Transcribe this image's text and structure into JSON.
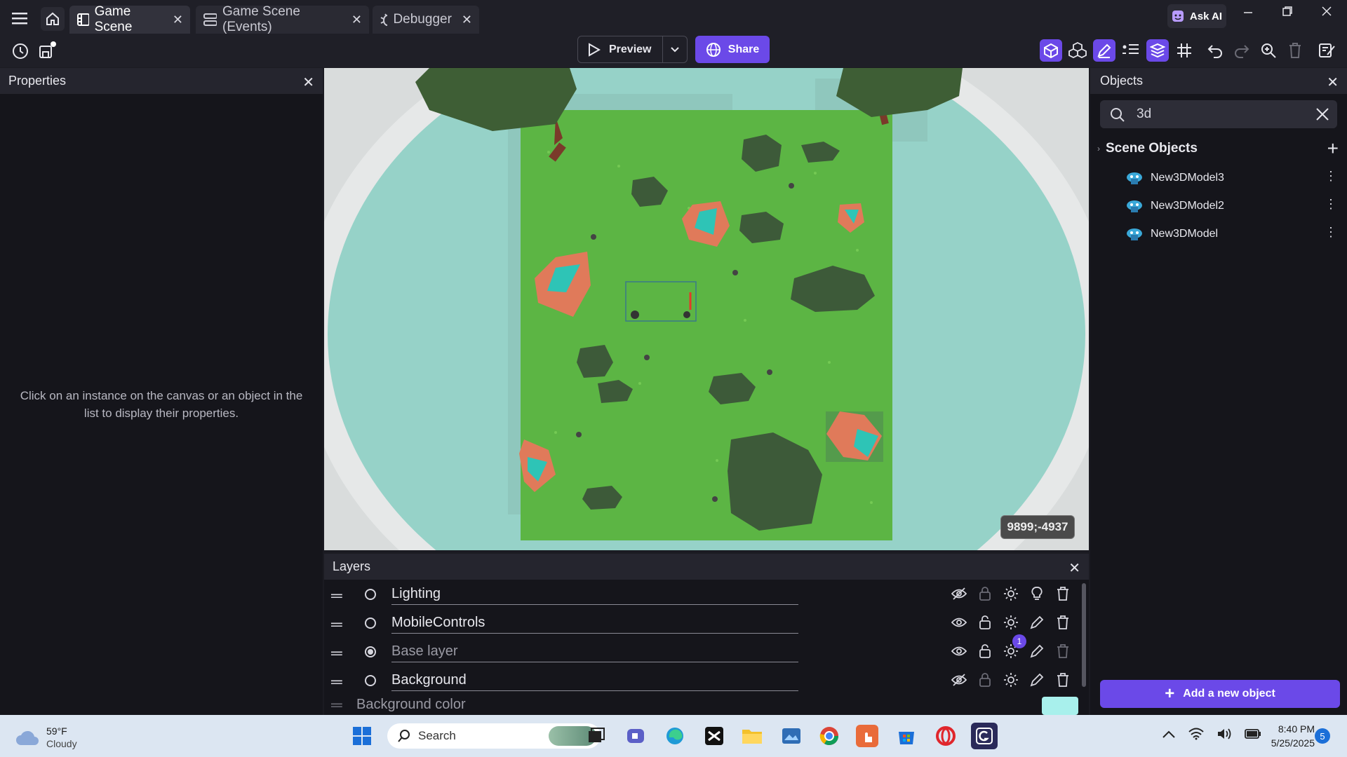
{
  "window": {
    "tabs": [
      {
        "label": "Game Scene",
        "active": true
      },
      {
        "label": "Game Scene (Events)",
        "active": false
      },
      {
        "label": "Debugger",
        "active": false
      }
    ],
    "ask_ai_label": "Ask AI"
  },
  "toolbar": {
    "preview_label": "Preview",
    "share_label": "Share"
  },
  "properties": {
    "title": "Properties",
    "empty_message_line1": "Click on an instance on the canvas or an object in the",
    "empty_message_line2": "list to display their properties."
  },
  "canvas": {
    "coordinates": "9899;-4937"
  },
  "layers": {
    "title": "Layers",
    "items": [
      {
        "name": "Lighting",
        "visible": false,
        "selected": false
      },
      {
        "name": "MobileControls",
        "visible": true,
        "selected": false
      },
      {
        "name": "Base layer",
        "visible": true,
        "selected": true,
        "badge": "1"
      },
      {
        "name": "Background",
        "visible": false,
        "selected": false
      }
    ],
    "background_color_label": "Background color",
    "background_color": "#a8f0ec"
  },
  "objects": {
    "title": "Objects",
    "search_value": "3d",
    "group_label": "Scene Objects",
    "items": [
      "New3DModel3",
      "New3DModel2",
      "New3DModel"
    ],
    "add_button_label": "Add a new object"
  },
  "taskbar": {
    "weather_temp": "59°F",
    "weather_desc": "Cloudy",
    "search_label": "Search",
    "time": "8:40 PM",
    "date": "5/25/2025",
    "notification_count": "5"
  },
  "colors": {
    "accent": "#6b49e8",
    "grass": "#5cb544",
    "sky": "#96d2c8"
  }
}
